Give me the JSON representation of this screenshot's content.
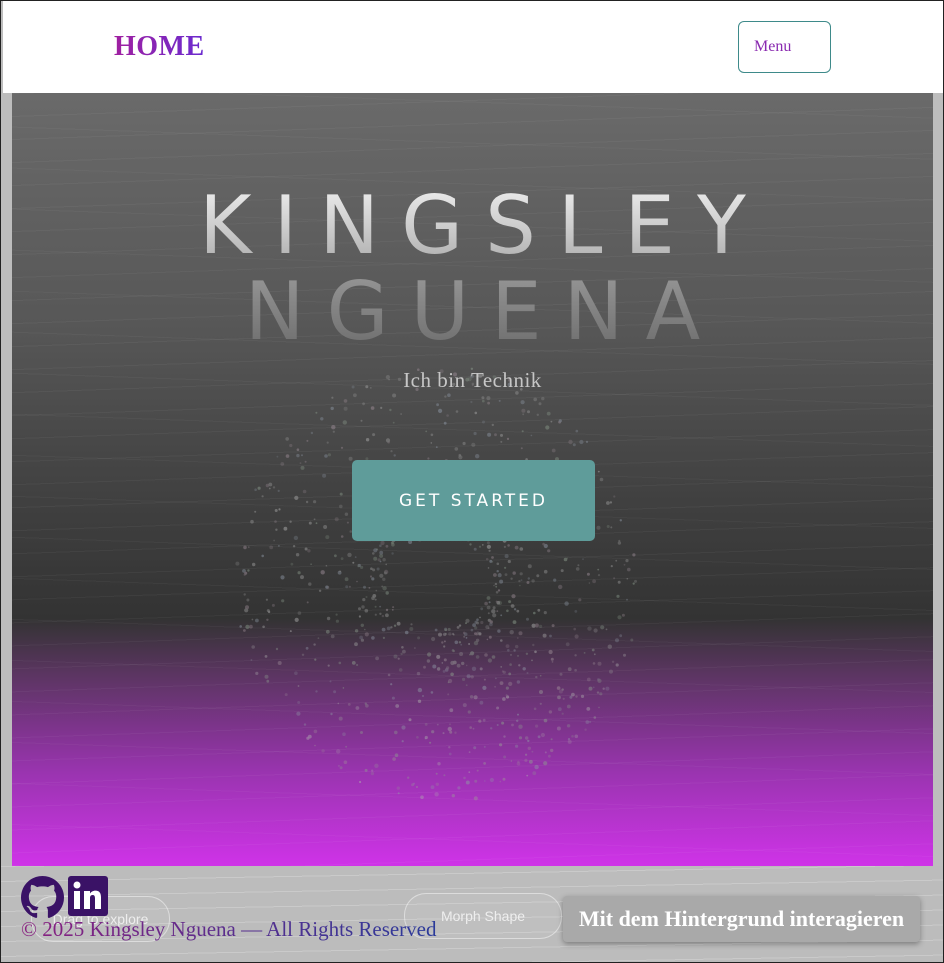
{
  "header": {
    "home_label": "HOME",
    "menu_label": "Menu"
  },
  "hero": {
    "title_line1": "KINGSLEY",
    "title_line2": "NGUENA",
    "subtitle": "Ich bin Technik",
    "cta_label": "GET STARTED"
  },
  "controls": {
    "drag_label": "Drag to explore",
    "morph_label": "Morph Shape",
    "interact_label": "Mit dem Hintergrund interagieren"
  },
  "footer": {
    "copyright": "© 2025 Kingsley Nguena — All Rights Reserved",
    "social": [
      {
        "name": "github-icon"
      },
      {
        "name": "linkedin-icon"
      }
    ]
  },
  "colors": {
    "accent_purple": "#a020a0",
    "cta_teal": "#5f9c9a",
    "hero_gradient_bottom": "#cf33e8"
  }
}
